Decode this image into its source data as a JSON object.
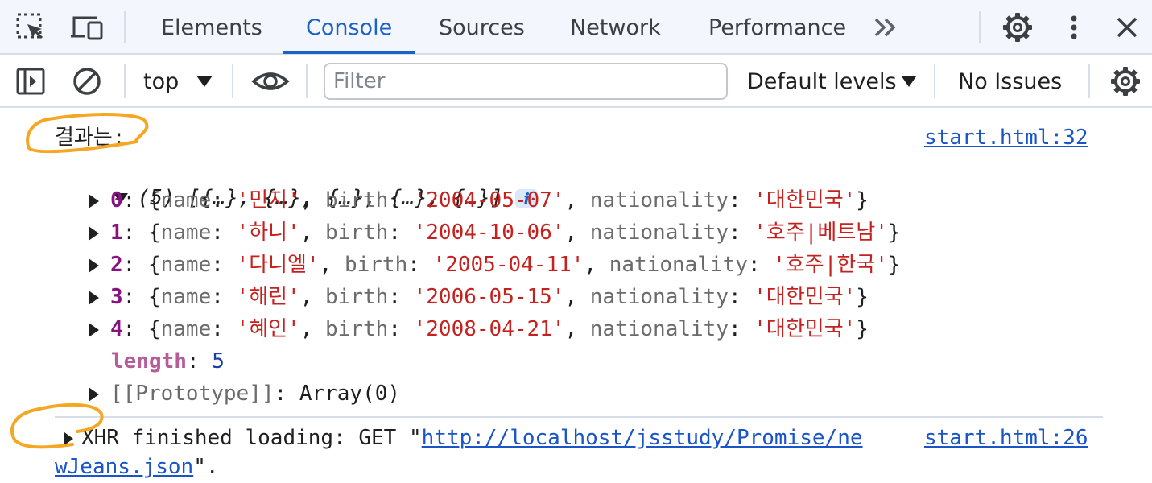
{
  "tabbar": {
    "tabs": [
      {
        "label": "Elements"
      },
      {
        "label": "Console"
      },
      {
        "label": "Sources"
      },
      {
        "label": "Network"
      },
      {
        "label": "Performance"
      }
    ],
    "active_tab": "Console",
    "more_tabs": "»"
  },
  "toolbar": {
    "context": "top",
    "filter_placeholder": "Filter",
    "filter_value": "",
    "levels": "Default levels",
    "issues": "No Issues"
  },
  "console": {
    "log1": {
      "message": "결과는:",
      "source": "start.html:32",
      "array_summary": "(5) [{…}, {…}, {…}, {…}, {…}]",
      "info_badge": "i",
      "items": [
        {
          "index": "0",
          "name": "'민지'",
          "birth": "'2004-05-07'",
          "nationality": "'대한민국'"
        },
        {
          "index": "1",
          "name": "'하니'",
          "birth": "'2004-10-06'",
          "nationality": "'호주|베트남'"
        },
        {
          "index": "2",
          "name": "'다니엘'",
          "birth": "'2005-04-11'",
          "nationality": "'호주|한국'"
        },
        {
          "index": "3",
          "name": "'해린'",
          "birth": "'2006-05-15'",
          "nationality": "'대한민국'"
        },
        {
          "index": "4",
          "name": "'혜인'",
          "birth": "'2008-04-21'",
          "nationality": "'대한민국'"
        }
      ],
      "length_key": "length",
      "length_value": "5",
      "prototype_key": "[[Prototype]]",
      "prototype_value": "Array(0)"
    },
    "log2": {
      "prefix": "XHR finished loading: GET \"",
      "url_part1": "http://localhost/jsstudy/Promise/ne",
      "url_part2": "wJeans.json",
      "suffix": "\".",
      "source": "start.html:26"
    }
  },
  "colors": {
    "accent": "#1a63c6",
    "string": "#c5221f",
    "index": "#881280",
    "number": "#1a3ea6",
    "annotation": "#f5a623"
  }
}
